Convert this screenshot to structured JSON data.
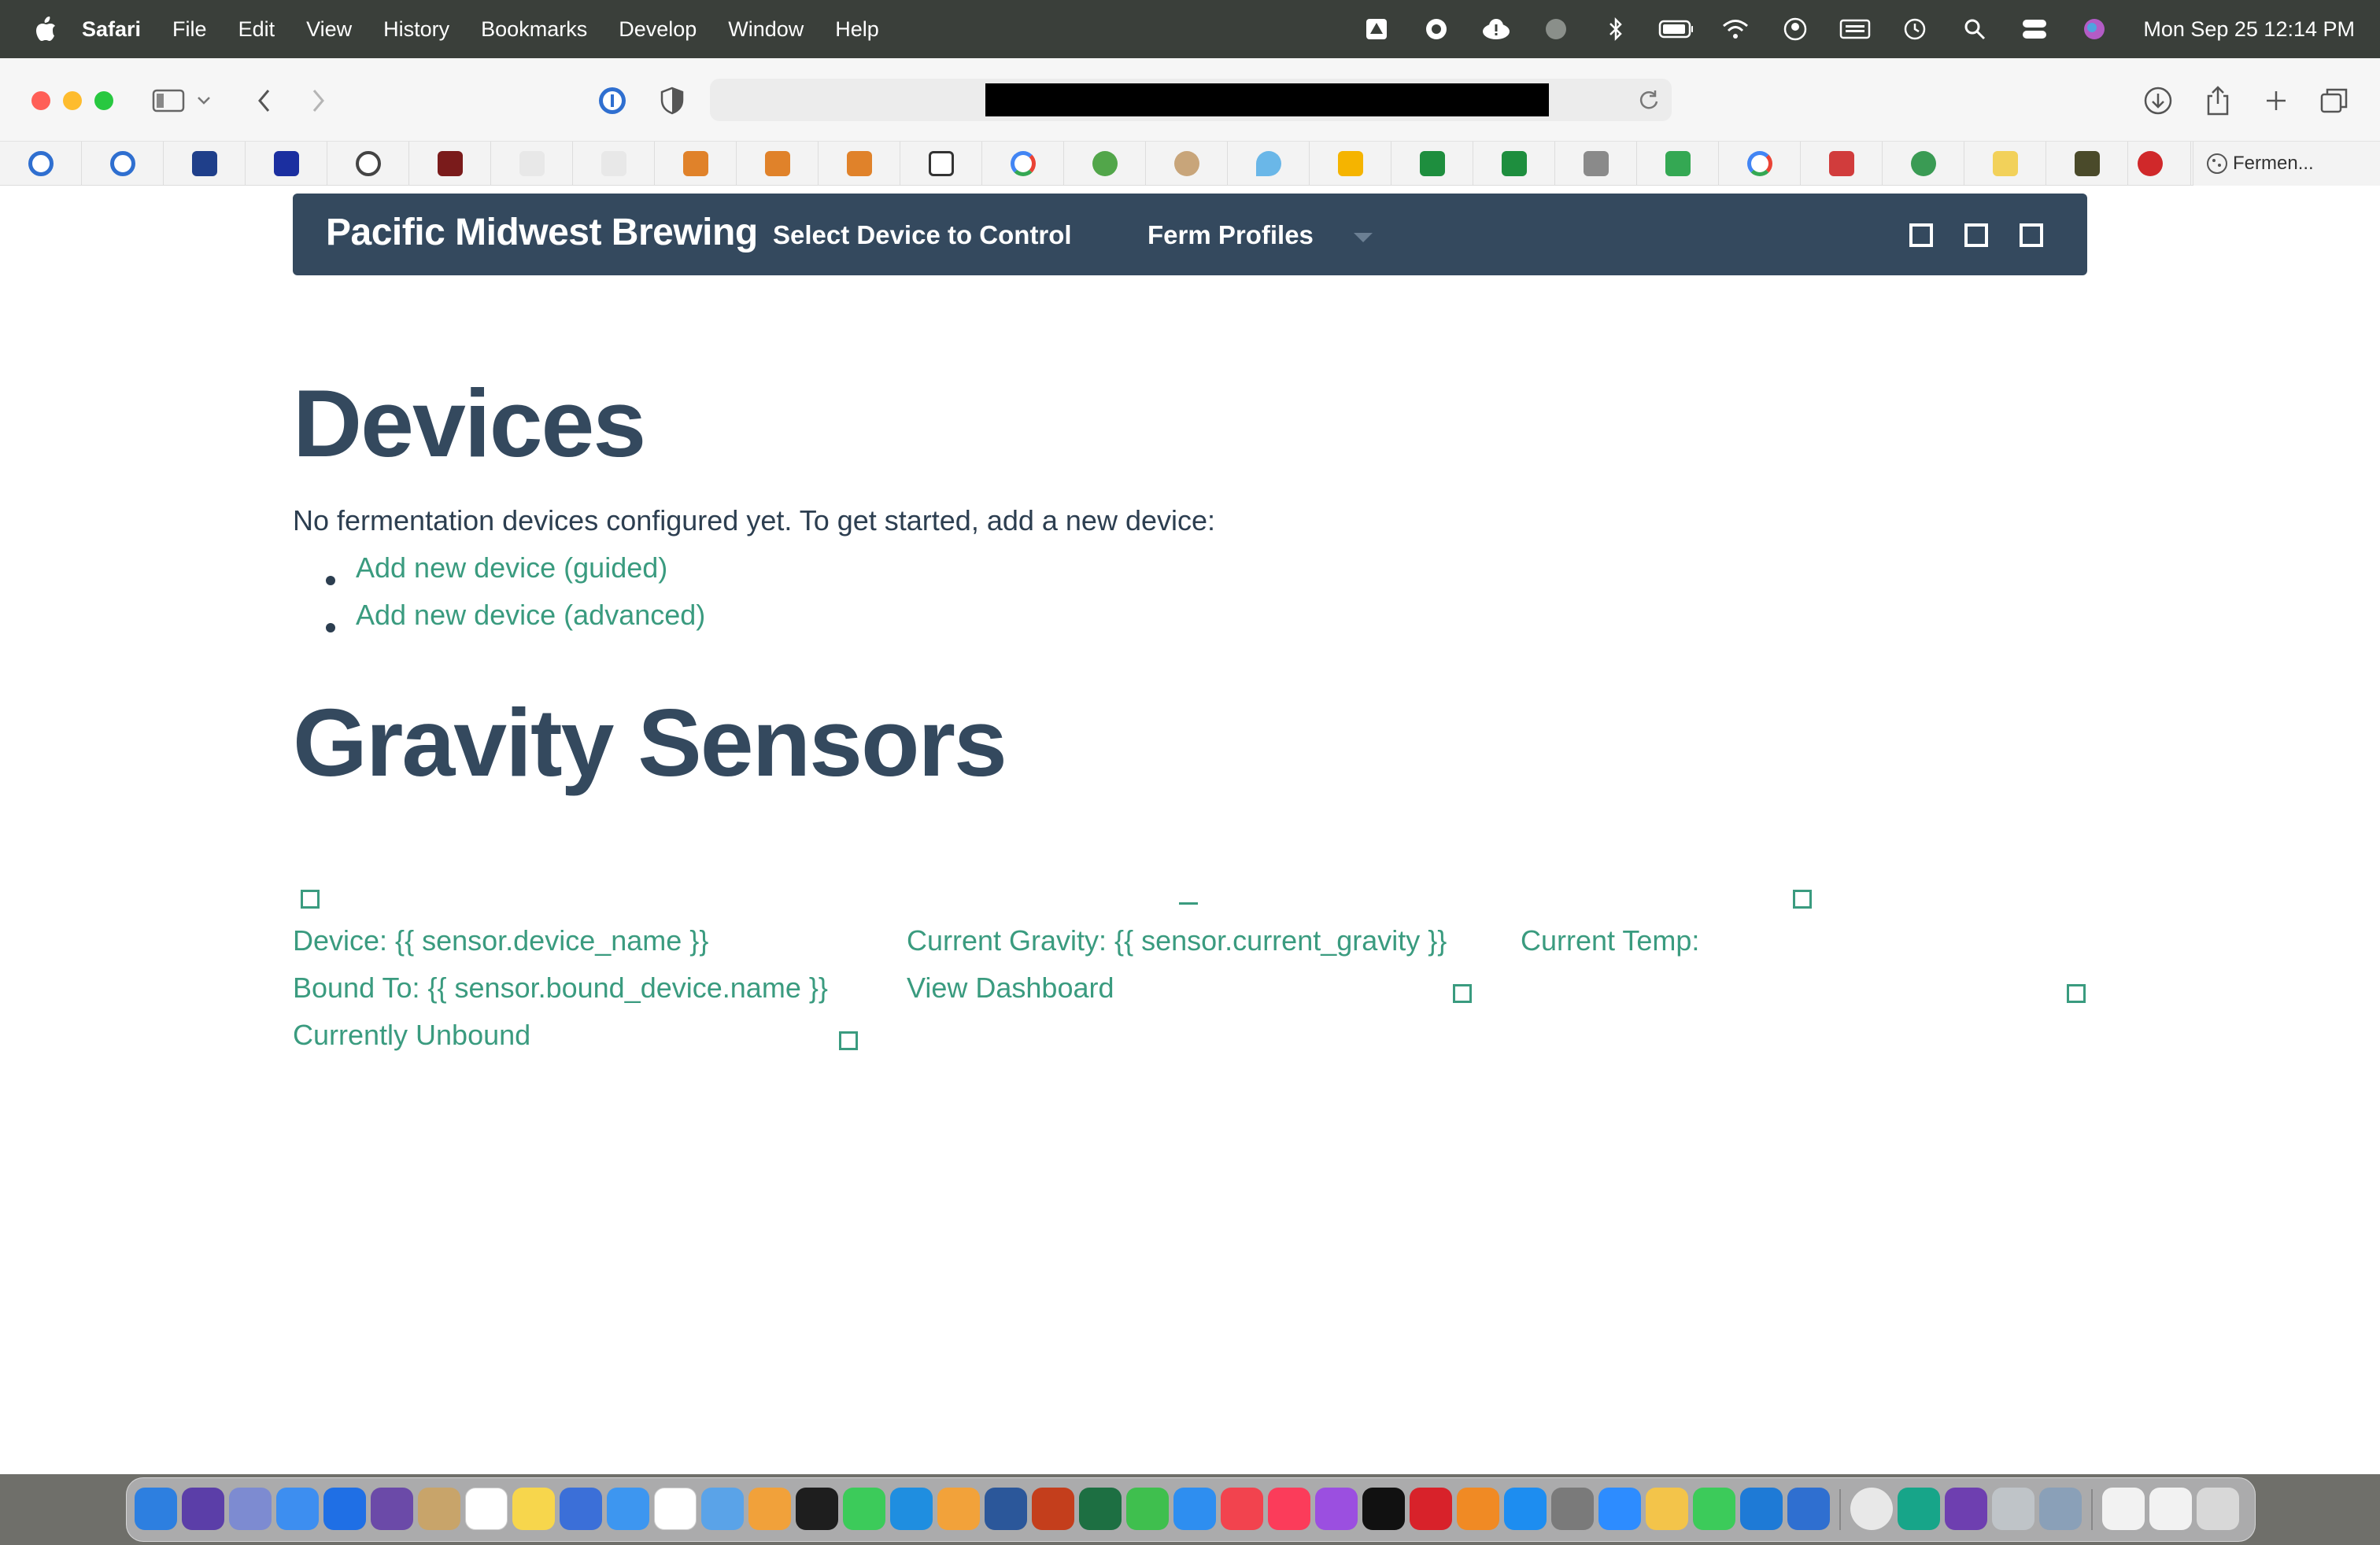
{
  "menubar": {
    "app_name": "Safari",
    "items": [
      "File",
      "Edit",
      "View",
      "History",
      "Bookmarks",
      "Develop",
      "Window",
      "Help"
    ],
    "clock": "Mon Sep 25  12:14 PM"
  },
  "favorites_tab_label": "Fermen...",
  "navbar": {
    "brand": "Pacific Midwest Brewing",
    "device_dropdown": "Select Device to Control",
    "ferm_profiles": "Ferm Profiles"
  },
  "devices": {
    "heading": "Devices",
    "intro": "No fermentation devices configured yet. To get started, add a new device:",
    "links": [
      "Add new device (guided)",
      "Add new device (advanced)"
    ]
  },
  "gravity": {
    "heading": "Gravity Sensors",
    "device_label": "Device: {{ sensor.device_name }}",
    "bound_label": "Bound To: {{ sensor.bound_device.name }}",
    "unbound_label": "Currently Unbound",
    "current_gravity": "Current Gravity: {{ sensor.current_gravity }}",
    "view_dashboard": "View Dashboard",
    "current_temp": "Current Temp:"
  },
  "colors": {
    "navbar": "#34495e",
    "link": "#3a9b7f",
    "heading": "#34495e"
  }
}
